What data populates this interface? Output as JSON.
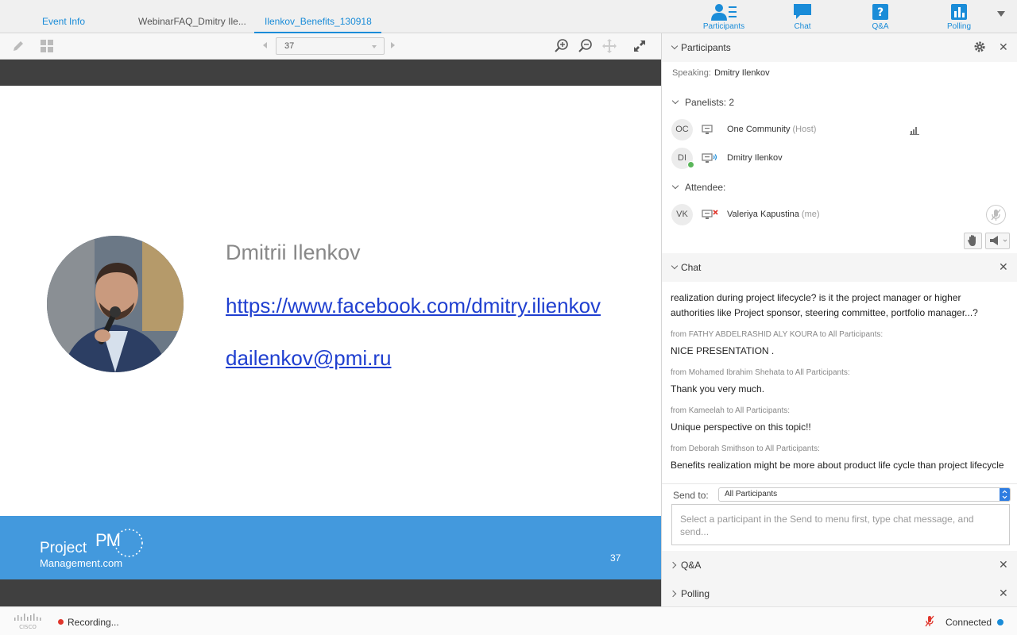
{
  "tabs": {
    "event_info": "Event Info",
    "webinar_faq": "WebinarFAQ_Dmitry Ile...",
    "benefits": "Ilenkov_Benefits_130918"
  },
  "panel_tabs": {
    "participants": "Participants",
    "chat": "Chat",
    "qa": "Q&A",
    "polling": "Polling"
  },
  "toolbar": {
    "page_number": "37"
  },
  "slide": {
    "name": "Dmitrii Ilenkov",
    "facebook": "https://www.facebook.com/dmitry.ilienkov",
    "email": "dailenkov@pmi.ru",
    "logo_line1": "Project",
    "logo_pm": "PM",
    "logo_line2": "Management.com",
    "page": "37"
  },
  "participants": {
    "title": "Participants",
    "speaking_label": "Speaking:",
    "speaking_name": "Dmitry Ilenkov",
    "panelists_label": "Panelists: 2",
    "attendee_label": "Attendee:",
    "panelists": [
      {
        "initials": "OC",
        "name": "One Community",
        "role": "(Host)"
      },
      {
        "initials": "DI",
        "name": "Dmitry Ilenkov",
        "role": ""
      }
    ],
    "attendees": [
      {
        "initials": "VK",
        "name": "Valeriya Kapustina",
        "role": "(me)"
      }
    ]
  },
  "chat": {
    "title": "Chat",
    "messages": [
      {
        "from": "",
        "text": "realization during project lifecycle? is it the project manager or higher authorities like Project sponsor, steering committee, portfolio manager...?"
      },
      {
        "from": "from FATHY ABDELRASHID ALY KOURA to All Participants:",
        "text": "NICE PRESENTATION ."
      },
      {
        "from": "from Mohamed Ibrahim Shehata to All Participants:",
        "text": "Thank you very much."
      },
      {
        "from": "from Kameelah to All Participants:",
        "text": "Unique perspective on this topic!!"
      },
      {
        "from": "from Deborah Smithson to All Participants:",
        "text": "Benefits realization might be more about product life cycle than project lifecycle"
      }
    ],
    "send_to_label": "Send to:",
    "send_to_value": "All Participants",
    "input_placeholder": "Select a participant in the Send to menu first, type chat message, and send..."
  },
  "qa": {
    "title": "Q&A"
  },
  "polling": {
    "title": "Polling"
  },
  "status": {
    "cisco": "CISCO",
    "recording": "Recording...",
    "connected": "Connected"
  },
  "colors": {
    "accent": "#1a8cd8",
    "slide_footer": "#4399dd",
    "slide_band": "#404040",
    "recording": "#e0362c"
  }
}
